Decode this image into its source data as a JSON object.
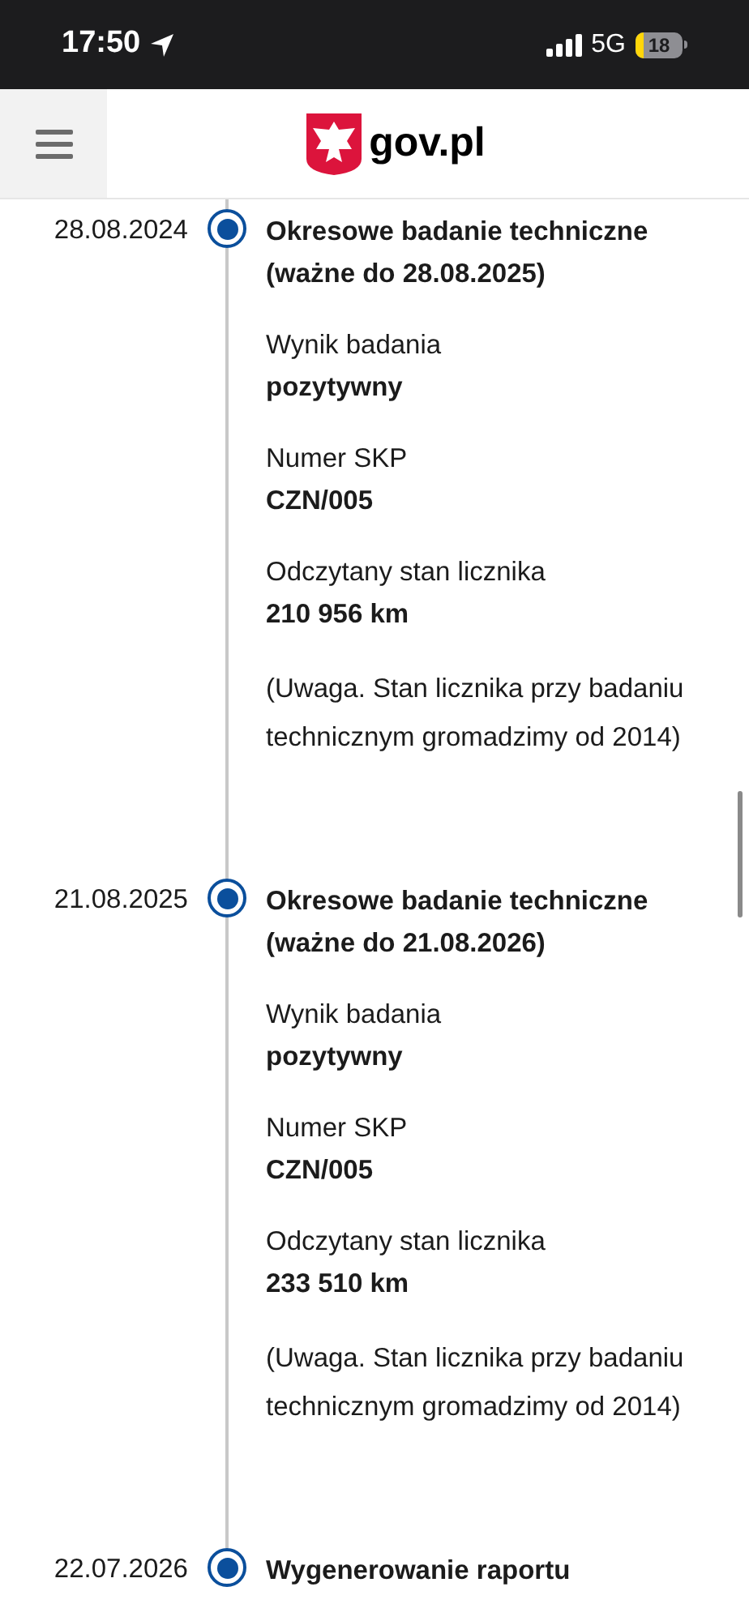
{
  "status_bar": {
    "time": "17:50",
    "network": "5G",
    "battery": "18"
  },
  "header": {
    "logo_text": "gov.pl"
  },
  "events": [
    {
      "date": "28.08.2024",
      "title_lines": [
        "Okresowe badanie techniczne",
        "(ważne do 28.08.2025)"
      ],
      "fields": [
        {
          "label": "Wynik badania",
          "value": "pozytywny"
        },
        {
          "label": "Numer SKP",
          "value": "CZN/005"
        },
        {
          "label": "Odczytany stan licznika",
          "value": "210 956 km"
        }
      ],
      "note": "(Uwaga. Stan licznika przy badaniu technicznym gromadzimy od 2014)"
    },
    {
      "date": "21.08.2025",
      "title_lines": [
        "Okresowe badanie techniczne",
        "(ważne do 21.08.2026)"
      ],
      "fields": [
        {
          "label": "Wynik badania",
          "value": "pozytywny"
        },
        {
          "label": "Numer SKP",
          "value": "CZN/005"
        },
        {
          "label": "Odczytany stan licznika",
          "value": "233 510 km"
        }
      ],
      "note": "(Uwaga. Stan licznika przy badaniu technicznym gromadzimy od 2014)"
    },
    {
      "date": "22.07.2026",
      "title_lines": [
        "Wygenerowanie raportu"
      ]
    }
  ]
}
